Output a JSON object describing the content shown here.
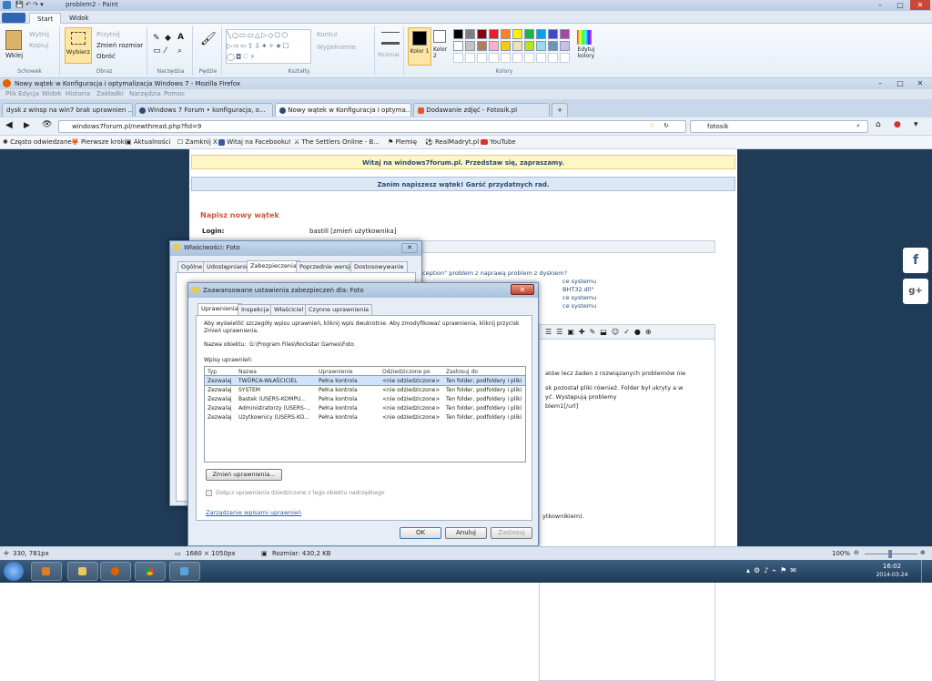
{
  "paint": {
    "title": "problem2 - Paint",
    "tabs": [
      "Start",
      "Widok"
    ],
    "groups": {
      "clipboard": {
        "paste": "Wklej",
        "cut": "Wytnij",
        "copy": "Kopiuj",
        "label": "Schowek"
      },
      "image": {
        "select": "Wybierz",
        "crop": "Przytnij",
        "resize": "Zmień rozmiar",
        "rotate": "Obróć",
        "label": "Obraz"
      },
      "tools": {
        "label": "Narzędzia"
      },
      "brushes": {
        "label": "Pędzle"
      },
      "shapes": {
        "outline": "Kontur",
        "fill": "Wypełnienie",
        "label": "Kształty"
      },
      "size": {
        "label": "Rozmiar"
      },
      "colors": {
        "color1": "Kolor 1",
        "color2": "Kolor 2",
        "edit": "Edytuj kolory",
        "label": "Kolory"
      }
    },
    "palette": [
      "#000000",
      "#7f7f7f",
      "#880015",
      "#ed1c24",
      "#ff7f27",
      "#fff200",
      "#22b14c",
      "#00a2e8",
      "#3f48cc",
      "#a349a4",
      "#ffffff",
      "#c3c3c3",
      "#b97a57",
      "#ffaec9",
      "#ffc90e",
      "#efe4b0",
      "#b5e61d",
      "#99d9ea",
      "#7092be",
      "#c8bfe7"
    ],
    "status": {
      "coords": "330, 781px",
      "size": "1680 × 1050px",
      "file_size": "Rozmiar: 430,2 KB",
      "zoom": "100%"
    }
  },
  "firefox": {
    "title": "Nowy wątek w Konfiguracja i optymalizacja Windows 7 - Mozilla Firefox",
    "menu": [
      "Plik",
      "Edycja",
      "Widok",
      "Historia",
      "Zakładki",
      "Narzędzia",
      "Pomoc"
    ],
    "tabs": [
      "dysk z winsp na win7 brak uprawnien ...",
      "Windows 7 Forum • konfiguracja, o...",
      "Nowy wątek w Konfiguracja i optyma...",
      "Dodawanie zdjęć - Fotosik.pl"
    ],
    "url": "windows7forum.pl/newthread.php?fid=9",
    "search": "fotosik",
    "bookmarks": [
      "Często odwiedzane",
      "Pierwsze kroki",
      "Aktualności",
      "Zamknij X",
      "Witaj na Facebooku!",
      "The Settlers Online - B...",
      "Plemię",
      "RealMadryt.pl",
      "YouTube"
    ]
  },
  "forum": {
    "welcome": "Witaj na windows7forum.pl. Przedstaw się, zapraszamy.",
    "before_post": "Zanim napiszesz wątek! Garść przydatnych rad.",
    "heading": "Napisz nowy wątek",
    "login_label": "Login:",
    "login_value": "bastill [zmień użytkownika]",
    "related": [
      "ception\" problem z naprawą problem z dyskiem?",
      "ce systemu",
      "BHT32.dll\"",
      "ce systemu",
      "ce systemu"
    ],
    "body_lines": [
      "atów lecz żaden z rozwiązanych problemów nie",
      "sk pozostał pliki również. Folder był ukryty a w",
      "yć. Występują problemy",
      "blem1[/url]"
    ],
    "footer_text": "ytkownikiem)."
  },
  "props": {
    "title": "Właściwości: Foto",
    "tabs": [
      "Ogólne",
      "Udostępnianie",
      "Zabezpieczenia",
      "Poprzednie wersje",
      "Dostosowywanie"
    ]
  },
  "adv": {
    "title": "Zaawansowane ustawienia zabezpieczeń dla: Foto",
    "tabs": [
      "Uprawnienia",
      "Inspekcja",
      "Właściciel",
      "Czynne uprawnienia"
    ],
    "description": "Aby wyświetlić szczegóły wpisu uprawnień, kliknij wpis dwukrotnie. Aby zmodyfikować uprawnienia, kliknij przycisk Zmień uprawnienia.",
    "object_label": "Nazwa obiektu:",
    "object_value": "G:\\Program Files\\Rockstar Games\\Foto",
    "entries_label": "Wpisy uprawnień:",
    "columns": [
      "Typ",
      "Nazwa",
      "Uprawnienie",
      "Odziedziczone po",
      "Zastosuj do"
    ],
    "rows": [
      [
        "Zezwalaj",
        "TWÓRCA-WŁAŚCICIEL",
        "Pełna kontrola",
        "<nie odziedziczone>",
        "Ten folder, podfoldery i pliki"
      ],
      [
        "Zezwalaj",
        "SYSTEM",
        "Pełna kontrola",
        "<nie odziedziczone>",
        "Ten folder, podfoldery i pliki"
      ],
      [
        "Zezwalaj",
        "Bastek (USERS-KOMPU...",
        "Pełna kontrola",
        "<nie odziedziczone>",
        "Ten folder, podfoldery i pliki"
      ],
      [
        "Zezwalaj",
        "Administratorzy (USERS-...",
        "Pełna kontrola",
        "<nie odziedziczone>",
        "Ten folder, podfoldery i pliki"
      ],
      [
        "Zezwalaj",
        "Użytkownicy (USERS-KO...",
        "Pełna kontrola",
        "<nie odziedziczone>",
        "Ten folder, podfoldery i pliki"
      ]
    ],
    "change_button": "Zmień uprawnienia...",
    "inherit_checkbox": "Dołącz uprawnienia dziedziczone z tego obiektu nadrzędnego",
    "manage_link": "Zarządzanie wpisami uprawnień",
    "ok": "OK",
    "cancel": "Anuluj",
    "apply": "Zastosuj"
  },
  "taskbar": {
    "time": "16:02",
    "date": "2014-03-24"
  },
  "social": {
    "facebook": "f",
    "gplus": "g+"
  }
}
